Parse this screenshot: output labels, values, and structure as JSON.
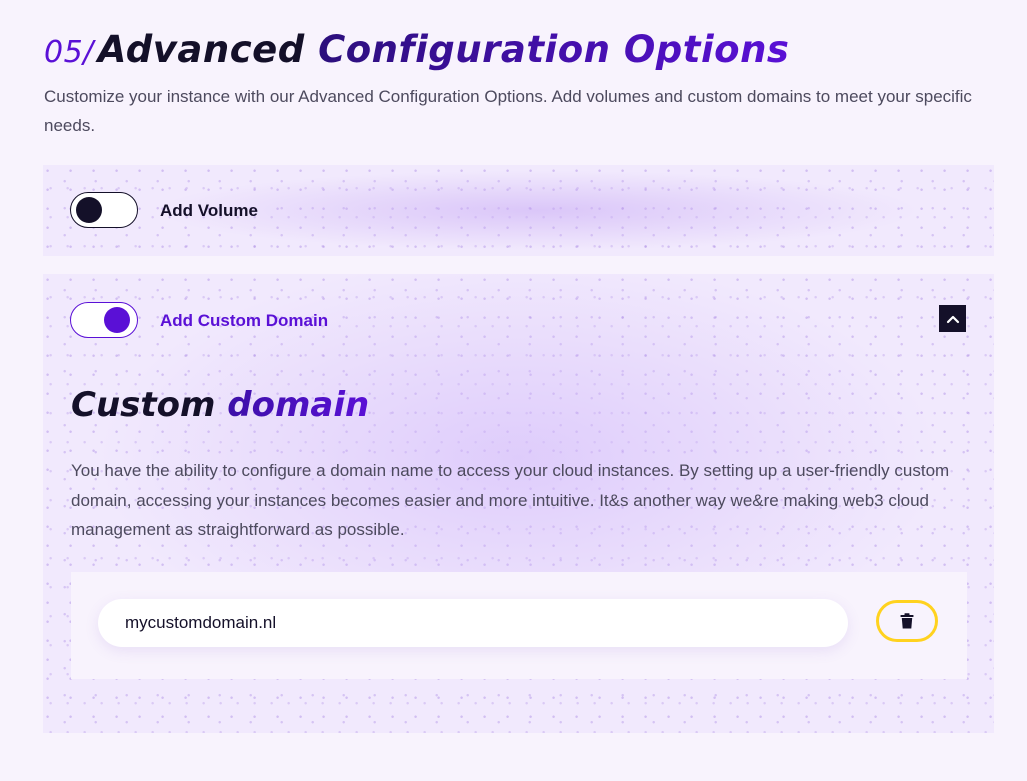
{
  "section": {
    "number": "05/",
    "title_first": "Advanced",
    "title_rest": "Configuration Options",
    "intro": "Customize your instance with our Advanced Configuration Options. Add volumes and custom domains to meet your specific needs."
  },
  "volume": {
    "toggle_state": "off",
    "label": "Add Volume"
  },
  "custom_domain": {
    "toggle_state": "on",
    "label": "Add Custom Domain",
    "collapse_icon": "chevron-up-icon",
    "heading_first": "Custom",
    "heading_rest": "domain",
    "description": "You have the ability to configure a domain name to access your cloud instances. By setting up a user-friendly custom domain, accessing your instances becomes easier and more intuitive. It&s another way we&re making web3 cloud management as straightforward as possible.",
    "domain_value": "mycustomdomain.nl",
    "delete_icon": "trash-icon"
  },
  "colors": {
    "accent": "#5a10d6",
    "dark": "#141029",
    "delete_border": "#ffd21f",
    "panel_bg": "#f1e9fd",
    "page_bg": "#f8f3fd"
  }
}
